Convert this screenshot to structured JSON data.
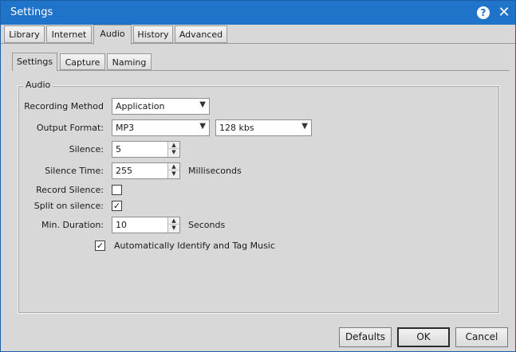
{
  "window": {
    "title": "Settings"
  },
  "top_tabs": [
    "Library",
    "Internet",
    "Audio",
    "History",
    "Advanced"
  ],
  "sub_tabs": [
    "Settings",
    "Capture",
    "Naming"
  ],
  "group": {
    "label": "Audio"
  },
  "form": {
    "recording_method": {
      "label": "Recording Method",
      "value": "Application"
    },
    "output_format": {
      "label": "Output Format:",
      "value": "MP3",
      "bitrate": "128 kbs"
    },
    "silence": {
      "label": "Silence:",
      "value": "5"
    },
    "silence_time": {
      "label": "Silence Time:",
      "value": "255",
      "unit": "Milliseconds"
    },
    "record_silence": {
      "label": "Record Silence:",
      "checked": false
    },
    "split_on_silence": {
      "label": "Split on silence:",
      "checked": true
    },
    "min_duration": {
      "label": "Min. Duration:",
      "value": "10",
      "unit": "Seconds"
    },
    "auto_identify": {
      "label": "Automatically Identify and Tag Music",
      "checked": true
    }
  },
  "buttons": {
    "defaults": "Defaults",
    "ok": "OK",
    "cancel": "Cancel"
  },
  "icons": {
    "help": "help-icon",
    "close": "close-icon",
    "check": "checkmark-icon",
    "dropdown": "chevron-down-icon"
  },
  "colors": {
    "titlebar": "#1f73c9",
    "background": "#d8d8d8"
  }
}
